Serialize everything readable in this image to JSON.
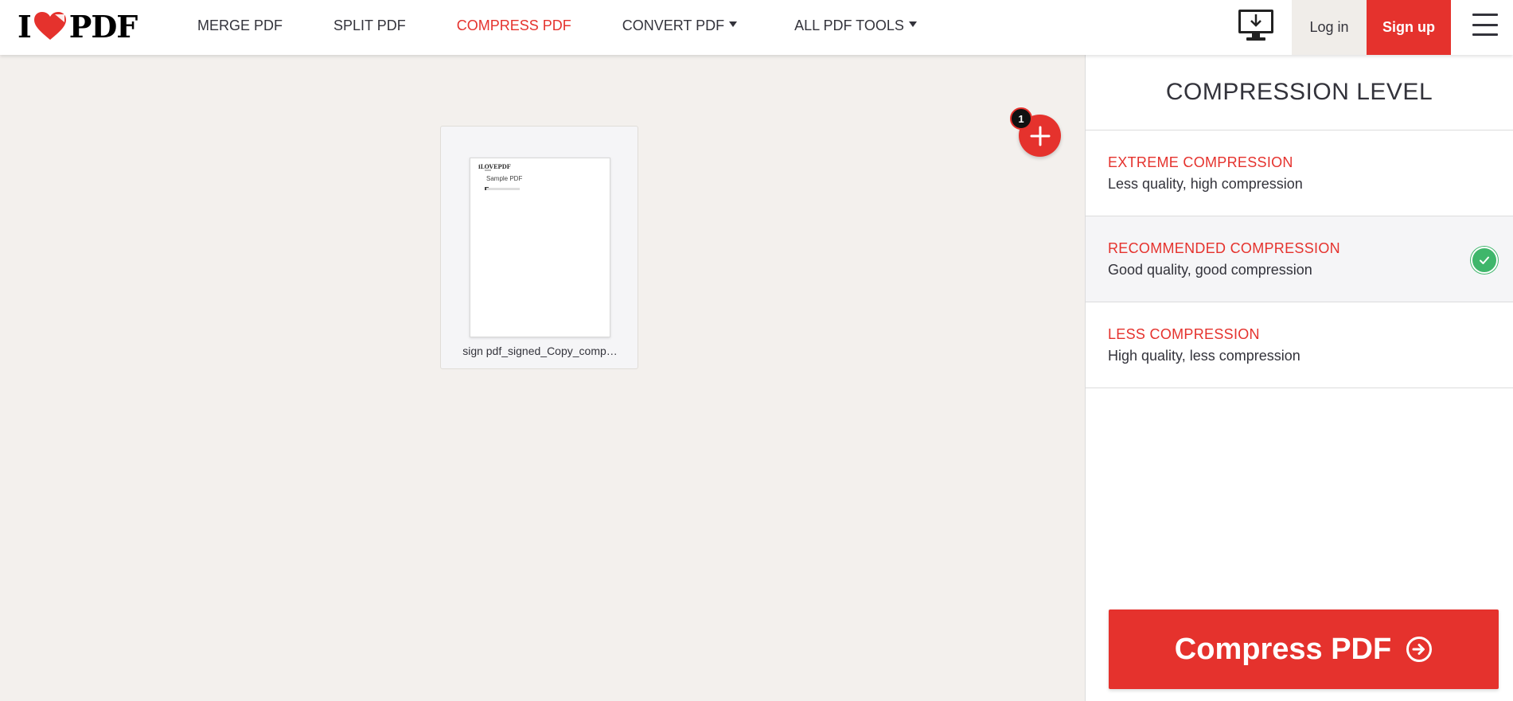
{
  "header": {
    "logo": {
      "left": "I",
      "right": "PDF"
    },
    "nav": [
      {
        "label": "MERGE PDF",
        "active": false,
        "dropdown": false
      },
      {
        "label": "SPLIT PDF",
        "active": false,
        "dropdown": false
      },
      {
        "label": "COMPRESS PDF",
        "active": true,
        "dropdown": false
      },
      {
        "label": "CONVERT PDF",
        "active": false,
        "dropdown": true
      },
      {
        "label": "ALL PDF TOOLS",
        "active": false,
        "dropdown": true
      }
    ],
    "desktop_icon": "desktop-download-icon",
    "login_label": "Log in",
    "signup_label": "Sign up",
    "menu_icon": "hamburger-menu-icon"
  },
  "workspace": {
    "file": {
      "name": "sign pdf_signed_Copy_comp…",
      "preview": {
        "logo": "iLOVEPDF",
        "title": "Sample PDF"
      }
    },
    "add_button_icon": "plus-icon",
    "file_count": "1"
  },
  "sidebar": {
    "title": "COMPRESSION LEVEL",
    "options": [
      {
        "title": "EXTREME COMPRESSION",
        "desc": "Less quality, high compression",
        "selected": false
      },
      {
        "title": "RECOMMENDED COMPRESSION",
        "desc": "Good quality, good compression",
        "selected": true
      },
      {
        "title": "LESS COMPRESSION",
        "desc": "High quality, less compression",
        "selected": false
      }
    ],
    "compress_button": {
      "label": "Compress PDF",
      "icon": "arrow-circle-right-icon"
    }
  },
  "colors": {
    "brand": "#e5322d",
    "selected_check": "#3fb66b",
    "background": "#f3f0ed"
  }
}
